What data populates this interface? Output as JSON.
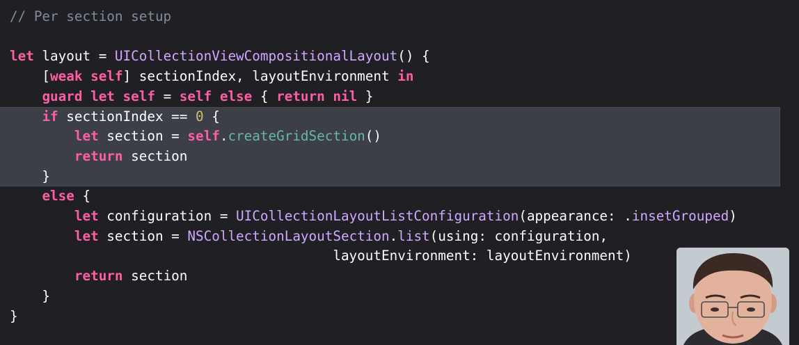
{
  "colors": {
    "background": "#1f1f24",
    "highlight": "#3c3f47",
    "comment": "#7f8c98",
    "keyword": "#fc5fa3",
    "plain": "#ffffff",
    "type": "#d0a8ff",
    "method": "#67b7a4",
    "number": "#d0bf69"
  },
  "code_lines": [
    [
      {
        "t": "// Per section setup",
        "c": "comment"
      }
    ],
    [],
    [
      {
        "t": "let",
        "c": "keyword"
      },
      {
        "t": " layout = ",
        "c": "plain"
      },
      {
        "t": "UICollectionViewCompositionalLayout",
        "c": "type"
      },
      {
        "t": "() {",
        "c": "plain"
      }
    ],
    [
      {
        "t": "    [",
        "c": "plain"
      },
      {
        "t": "weak",
        "c": "keyword"
      },
      {
        "t": " ",
        "c": "plain"
      },
      {
        "t": "self",
        "c": "keyword"
      },
      {
        "t": "] sectionIndex, layoutEnvironment ",
        "c": "plain"
      },
      {
        "t": "in",
        "c": "keyword"
      }
    ],
    [
      {
        "t": "    ",
        "c": "plain"
      },
      {
        "t": "guard",
        "c": "keyword"
      },
      {
        "t": " ",
        "c": "plain"
      },
      {
        "t": "let",
        "c": "keyword"
      },
      {
        "t": " ",
        "c": "plain"
      },
      {
        "t": "self",
        "c": "keyword"
      },
      {
        "t": " = ",
        "c": "plain"
      },
      {
        "t": "self",
        "c": "keyword"
      },
      {
        "t": " ",
        "c": "plain"
      },
      {
        "t": "else",
        "c": "keyword"
      },
      {
        "t": " { ",
        "c": "plain"
      },
      {
        "t": "return",
        "c": "keyword"
      },
      {
        "t": " ",
        "c": "plain"
      },
      {
        "t": "nil",
        "c": "keyword"
      },
      {
        "t": " }",
        "c": "plain"
      }
    ],
    [
      {
        "t": "    ",
        "c": "plain"
      },
      {
        "t": "if",
        "c": "keyword"
      },
      {
        "t": " sectionIndex == ",
        "c": "plain"
      },
      {
        "t": "0",
        "c": "number"
      },
      {
        "t": " {",
        "c": "plain"
      }
    ],
    [
      {
        "t": "        ",
        "c": "plain"
      },
      {
        "t": "let",
        "c": "keyword"
      },
      {
        "t": " section = ",
        "c": "plain"
      },
      {
        "t": "self",
        "c": "keyword"
      },
      {
        "t": ".",
        "c": "plain"
      },
      {
        "t": "createGridSection",
        "c": "method"
      },
      {
        "t": "()",
        "c": "plain"
      }
    ],
    [
      {
        "t": "        ",
        "c": "plain"
      },
      {
        "t": "return",
        "c": "keyword"
      },
      {
        "t": " section",
        "c": "plain"
      }
    ],
    [
      {
        "t": "    }",
        "c": "plain"
      }
    ],
    [
      {
        "t": "    ",
        "c": "plain"
      },
      {
        "t": "else",
        "c": "keyword"
      },
      {
        "t": " {",
        "c": "plain"
      }
    ],
    [
      {
        "t": "        ",
        "c": "plain"
      },
      {
        "t": "let",
        "c": "keyword"
      },
      {
        "t": " configuration = ",
        "c": "plain"
      },
      {
        "t": "UICollectionLayoutListConfiguration",
        "c": "type"
      },
      {
        "t": "(appearance: .",
        "c": "plain"
      },
      {
        "t": "insetGrouped",
        "c": "type"
      },
      {
        "t": ")",
        "c": "plain"
      }
    ],
    [
      {
        "t": "        ",
        "c": "plain"
      },
      {
        "t": "let",
        "c": "keyword"
      },
      {
        "t": " section = ",
        "c": "plain"
      },
      {
        "t": "NSCollectionLayoutSection",
        "c": "type"
      },
      {
        "t": ".",
        "c": "plain"
      },
      {
        "t": "list",
        "c": "type"
      },
      {
        "t": "(using: configuration,",
        "c": "plain"
      }
    ],
    [
      {
        "t": "                                        layoutEnvironment: layoutEnvironment)",
        "c": "plain"
      }
    ],
    [
      {
        "t": "        ",
        "c": "plain"
      },
      {
        "t": "return",
        "c": "keyword"
      },
      {
        "t": " section",
        "c": "plain"
      }
    ],
    [
      {
        "t": "    }",
        "c": "plain"
      }
    ],
    [
      {
        "t": "}",
        "c": "plain"
      }
    ]
  ]
}
